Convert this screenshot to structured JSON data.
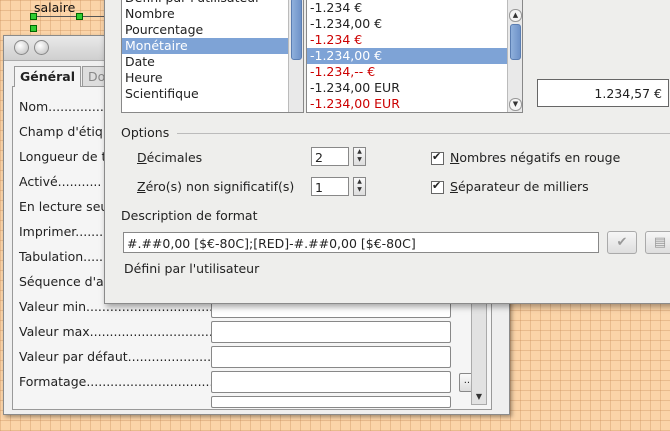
{
  "background": {
    "label": "salaire"
  },
  "properties_window": {
    "tabs": [
      "Général",
      "Do"
    ],
    "fields": [
      {
        "label": "Nom..........................."
      },
      {
        "label": "Champ d'étiq"
      },
      {
        "label": "Longueur de t"
      },
      {
        "label": "Activé..........."
      },
      {
        "label": "En lecture seu"
      },
      {
        "label": "Imprimer........."
      },
      {
        "label": "Tabulation......."
      },
      {
        "label": "Séquence d'a"
      },
      {
        "label": "Valeur min................................."
      },
      {
        "label": "Valeur max................................."
      },
      {
        "label": "Valeur par défaut........................."
      },
      {
        "label": "Formatage......................................"
      }
    ],
    "dots_button_label": "..."
  },
  "format_dialog": {
    "categories": [
      "Défini par l'utilisateur",
      "Nombre",
      "Pourcentage",
      "Monétaire",
      "Date",
      "Heure",
      "Scientifique"
    ],
    "selected_category": "Monétaire",
    "formats": [
      {
        "text": "-1.234 €",
        "red": false
      },
      {
        "text": "-1.234,00 €",
        "red": false
      },
      {
        "text": "-1.234 €",
        "red": true
      },
      {
        "text": "-1.234,00 €",
        "red": false,
        "selected": true
      },
      {
        "text": "-1.234,-- €",
        "red": true
      },
      {
        "text": "-1.234,00 EUR",
        "red": false
      },
      {
        "text": "-1.234,00 EUR",
        "red": true
      }
    ],
    "preview_value": "1.234,57 €",
    "options_label": "Options",
    "decimals_label_first": "D",
    "decimals_label_rest": "écimales",
    "decimals_value": "2",
    "leading_zeros_label_first": "Z",
    "leading_zeros_label_rest": "éro(s) non significatif(s)",
    "leading_zeros_value": "1",
    "negative_red_label_first": "N",
    "negative_red_label_rest": "ombres négatifs en rouge",
    "thousands_sep_label_first": "S",
    "thousands_sep_label_rest": "éparateur de milliers",
    "format_code_label": "Description de format",
    "format_code_value": "#.##0,00 [$€-80C];[RED]-#.##0,00 [$€-80C]",
    "comment": "Défini par l'utilisateur"
  }
}
